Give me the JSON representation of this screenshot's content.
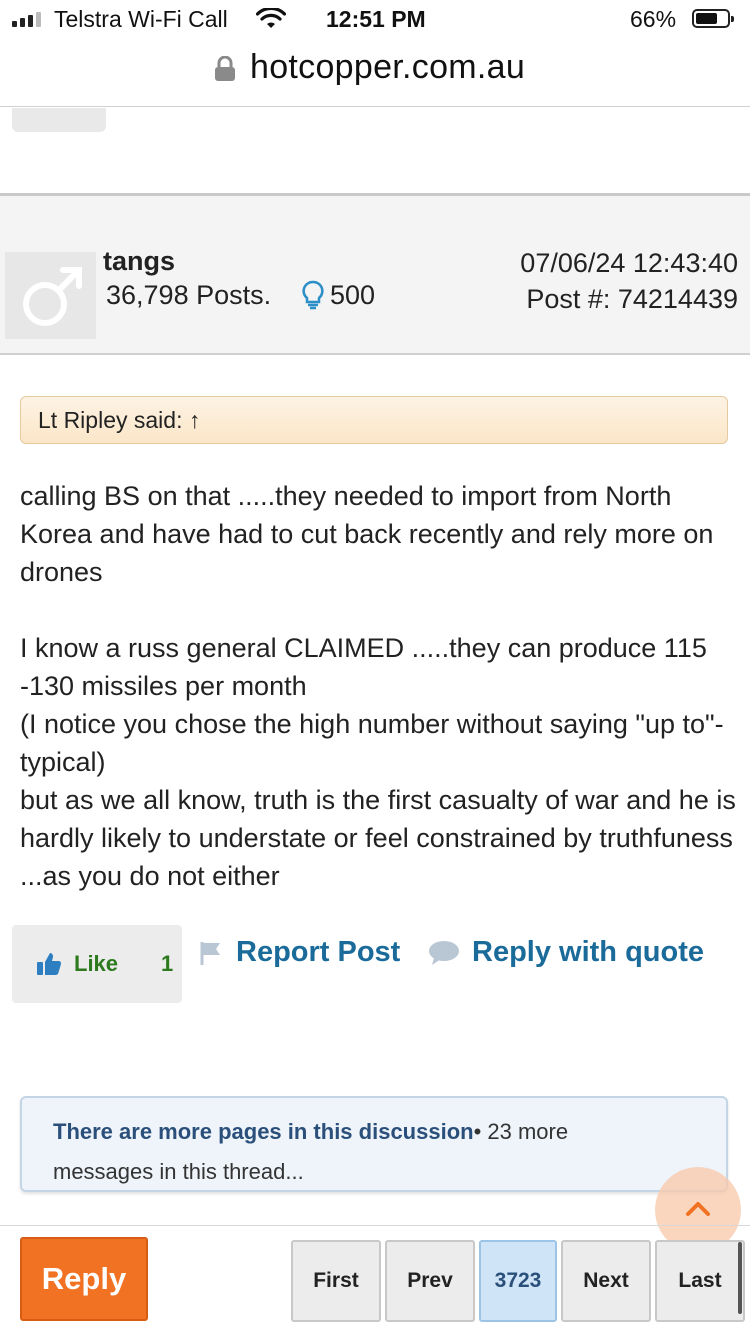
{
  "status_bar": {
    "carrier": "Telstra Wi-Fi Call",
    "time": "12:51 PM",
    "battery": "66%"
  },
  "browser": {
    "url": "hotcopper.com.au"
  },
  "post": {
    "username": "tangs",
    "posts": "36,798 Posts.",
    "likes_received": "500",
    "date": "07/06/24  12:43:40",
    "post_number": "Post #:  74214439",
    "quote_label": "Lt Ripley said: ↑",
    "body": {
      "p1": "calling BS on that .....they needed to import from North Korea and have had to cut back recently and rely more on drones",
      "p2": "I know a russ general CLAIMED .....they can produce 115 -130 missiles per month",
      "p3": "(I notice you chose the high number without saying \"up to\"- typical)",
      "p4": "but as we all know, truth is the first casualty of war and he is hardly likely to understate or feel constrained by truthfuness ...as you do not either"
    },
    "actions": {
      "like_label": "Like",
      "like_count": "1",
      "report_label": "Report Post",
      "reply_quote_label": "Reply with quote"
    }
  },
  "more_pages": {
    "bold": "There are more pages in this discussion",
    "rest": "• 23 more messages in this thread..."
  },
  "pagination": {
    "reply_label": "Reply",
    "first": "First",
    "prev": "Prev",
    "current": "3723",
    "next": "Next",
    "last": "Last"
  },
  "colors": {
    "accent_orange": "#f07222",
    "link_blue": "#1b6b9a",
    "like_green": "#2c7a1d"
  }
}
